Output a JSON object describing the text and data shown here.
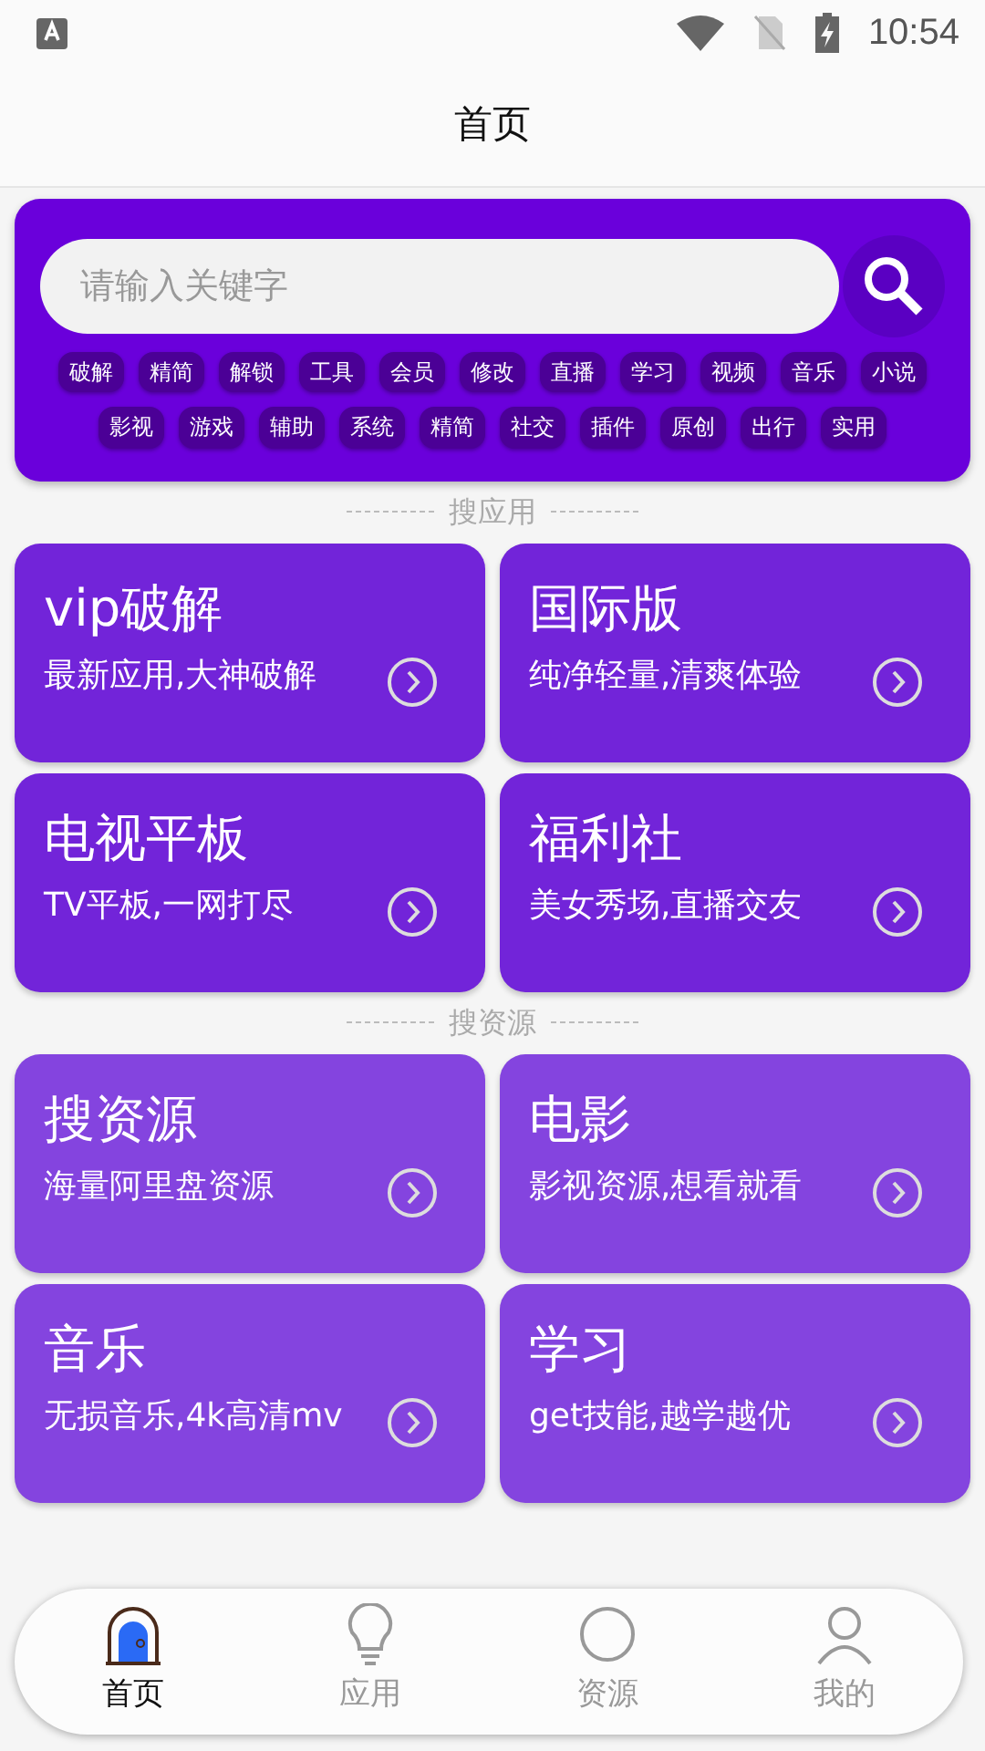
{
  "status_bar": {
    "time": "10:54"
  },
  "title": "首页",
  "search": {
    "placeholder": "请输入关键字"
  },
  "tag_rows": [
    [
      "破解",
      "精简",
      "解锁",
      "工具",
      "会员",
      "修改",
      "直播",
      "学习",
      "视频",
      "音乐",
      "小说"
    ],
    [
      "影视",
      "游戏",
      "辅助",
      "系统",
      "精简",
      "社交",
      "插件",
      "原创",
      "出行",
      "实用"
    ]
  ],
  "sections": [
    {
      "heading": "搜应用",
      "color": "#7224d9",
      "cards": [
        {
          "title": "vip破解",
          "subtitle": "最新应用,大神破解"
        },
        {
          "title": "国际版",
          "subtitle": "纯净轻量,清爽体验"
        },
        {
          "title": "电视平板",
          "subtitle": "TV平板,一网打尽"
        },
        {
          "title": "福利社",
          "subtitle": "美女秀场,直播交友"
        }
      ]
    },
    {
      "heading": "搜资源",
      "color": "#8444df",
      "cards": [
        {
          "title": "搜资源",
          "subtitle": "海量阿里盘资源"
        },
        {
          "title": "电影",
          "subtitle": "影视资源,想看就看"
        },
        {
          "title": "音乐",
          "subtitle": "无损音乐,4k高清mv"
        },
        {
          "title": "学习",
          "subtitle": "get技能,越学越优"
        }
      ]
    }
  ],
  "bottom_nav": [
    {
      "kind": "home",
      "label": "首页",
      "selected": true
    },
    {
      "kind": "apps",
      "label": "应用",
      "selected": false
    },
    {
      "kind": "resources",
      "label": "资源",
      "selected": false
    },
    {
      "kind": "profile",
      "label": "我的",
      "selected": false
    }
  ]
}
